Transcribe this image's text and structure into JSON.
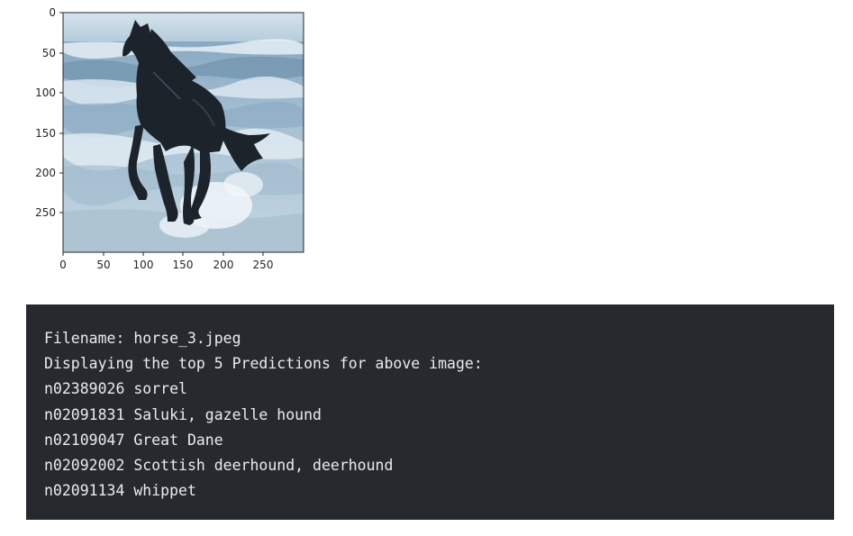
{
  "figure": {
    "image_subject": "black horse galloping through surf on a beach",
    "xticks": [
      "0",
      "50",
      "100",
      "150",
      "200",
      "250"
    ],
    "yticks": [
      "0",
      "50",
      "100",
      "150",
      "200",
      "250"
    ],
    "colors": {
      "sky": "#c9dbe8",
      "sea": "#8fb0c8",
      "foam": "#e8f1f7",
      "sand": "#b9ccd9",
      "horse": "#1c232a"
    }
  },
  "output": {
    "lines": [
      "Filename: horse_3.jpeg",
      "Displaying the top 5 Predictions for above image:",
      "n02389026 sorrel",
      "n02091831 Saluki, gazelle hound",
      "n02109047 Great Dane",
      "n02092002 Scottish deerhound, deerhound",
      "n02091134 whippet"
    ]
  }
}
